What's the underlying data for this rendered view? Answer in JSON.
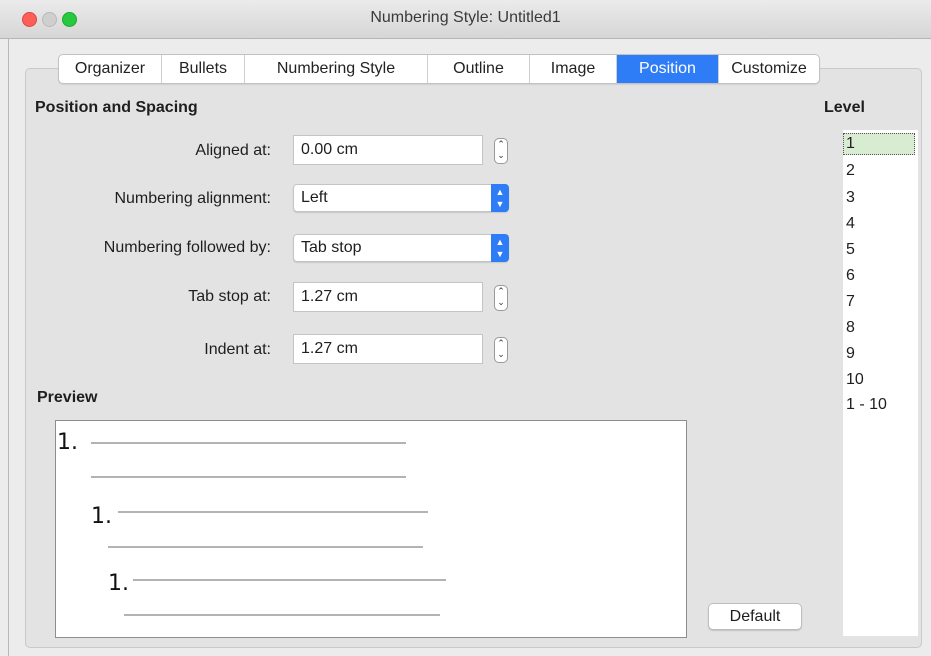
{
  "window": {
    "title": "Numbering Style: Untitled1"
  },
  "tabs": [
    {
      "label": "Organizer",
      "active": false
    },
    {
      "label": "Bullets",
      "active": false
    },
    {
      "label": "Numbering Style",
      "active": false
    },
    {
      "label": "Outline",
      "active": false
    },
    {
      "label": "Image",
      "active": false
    },
    {
      "label": "Position",
      "active": true
    },
    {
      "label": "Customize",
      "active": false
    }
  ],
  "position_spacing": {
    "heading": "Position and Spacing",
    "aligned_at": {
      "label": "Aligned at:",
      "value": "0.00 cm"
    },
    "numbering_alignment": {
      "label": "Numbering alignment:",
      "value": "Left"
    },
    "numbering_followed_by": {
      "label": "Numbering followed by:",
      "value": "Tab stop"
    },
    "tab_stop_at": {
      "label": "Tab stop at:",
      "value": "1.27 cm"
    },
    "indent_at": {
      "label": "Indent at:",
      "value": "1.27 cm"
    }
  },
  "preview": {
    "heading": "Preview",
    "numbers": [
      "1.",
      "1.",
      "1."
    ]
  },
  "level": {
    "heading": "Level",
    "items": [
      "1",
      "2",
      "3",
      "4",
      "5",
      "6",
      "7",
      "8",
      "9",
      "10",
      "1 - 10"
    ],
    "selected": "1"
  },
  "buttons": {
    "default": "Default"
  },
  "colors": {
    "accent": "#2f7df6",
    "selected_level_bg": "#d8ecd1"
  }
}
